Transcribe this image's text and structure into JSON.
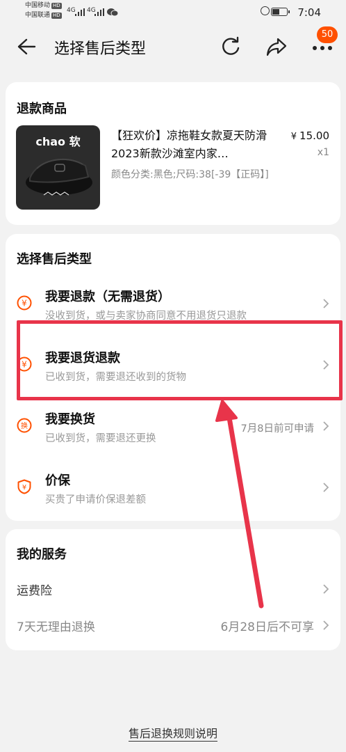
{
  "status_bar": {
    "carrier1": "中国移动",
    "carrier2": "中国联通",
    "hd": "HD",
    "network1": "4G",
    "network2": "4G",
    "time": "7:04",
    "battery_level": 0.45
  },
  "header": {
    "title": "选择售后类型",
    "notification_count": "50"
  },
  "refund_item": {
    "section_title": "退款商品",
    "image_brand": "chao 软",
    "name": "【狂欢价】凉拖鞋女款夏天防滑2023新款沙滩室内家…",
    "spec": "颜色分类:黑色;尺码:38[-39【正码】]",
    "price_symbol": "¥",
    "price": "15.00",
    "quantity": "x1"
  },
  "service_types": {
    "section_title": "选择售后类型",
    "options": [
      {
        "title": "我要退款（无需退货）",
        "subtitle": "没收到货，或与卖家协商同意不用退货只退款",
        "right_text": ""
      },
      {
        "title": "我要退货退款",
        "subtitle": "已收到货，需要退还收到的货物",
        "right_text": ""
      },
      {
        "title": "我要换货",
        "subtitle": "已收到货，需要退还更换",
        "right_text": "7月8日前可申请"
      },
      {
        "title": "价保",
        "subtitle": "买贵了申请价保退差额",
        "right_text": ""
      }
    ]
  },
  "my_services": {
    "section_title": "我的服务",
    "rows": [
      {
        "label": "运费险",
        "right_text": ""
      },
      {
        "label": "7天无理由退换",
        "right_text": "6月28日后不可享"
      }
    ]
  },
  "footer": {
    "rules_link": "售后退换规则说明"
  },
  "colors": {
    "accent": "#ff5000",
    "annotation": "#e8344a",
    "background": "#f2f2f2"
  }
}
